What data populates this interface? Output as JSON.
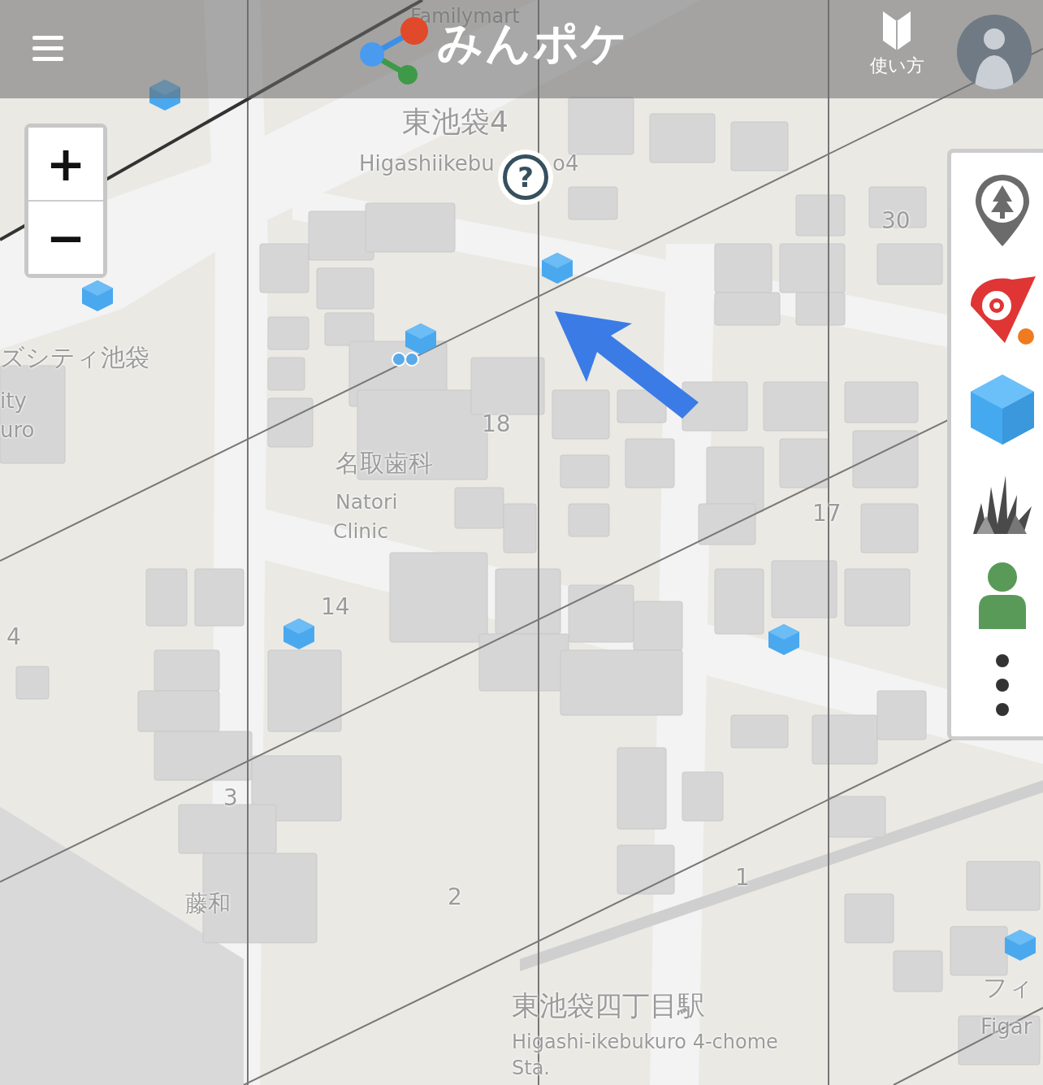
{
  "header": {
    "logo_text": "みんポケ",
    "guide_link": "使い方"
  },
  "zoom_controls": {
    "zoom_in": "+",
    "zoom_out": "−"
  },
  "help_button": "?",
  "map_labels": [
    "Familymart",
    "東池袋4",
    "Higashiikebu",
    "o4",
    "30",
    "ズシティ池袋",
    "ity",
    "uro",
    "18",
    "名取歯科",
    "Natori",
    "Clinic",
    "17",
    "14",
    "4",
    "3",
    "藤和",
    "2",
    "1",
    "東池袋四丁目駅",
    "Higashi-ikebukuro 4-chome",
    "Sta.",
    "フィ",
    "Figar"
  ]
}
